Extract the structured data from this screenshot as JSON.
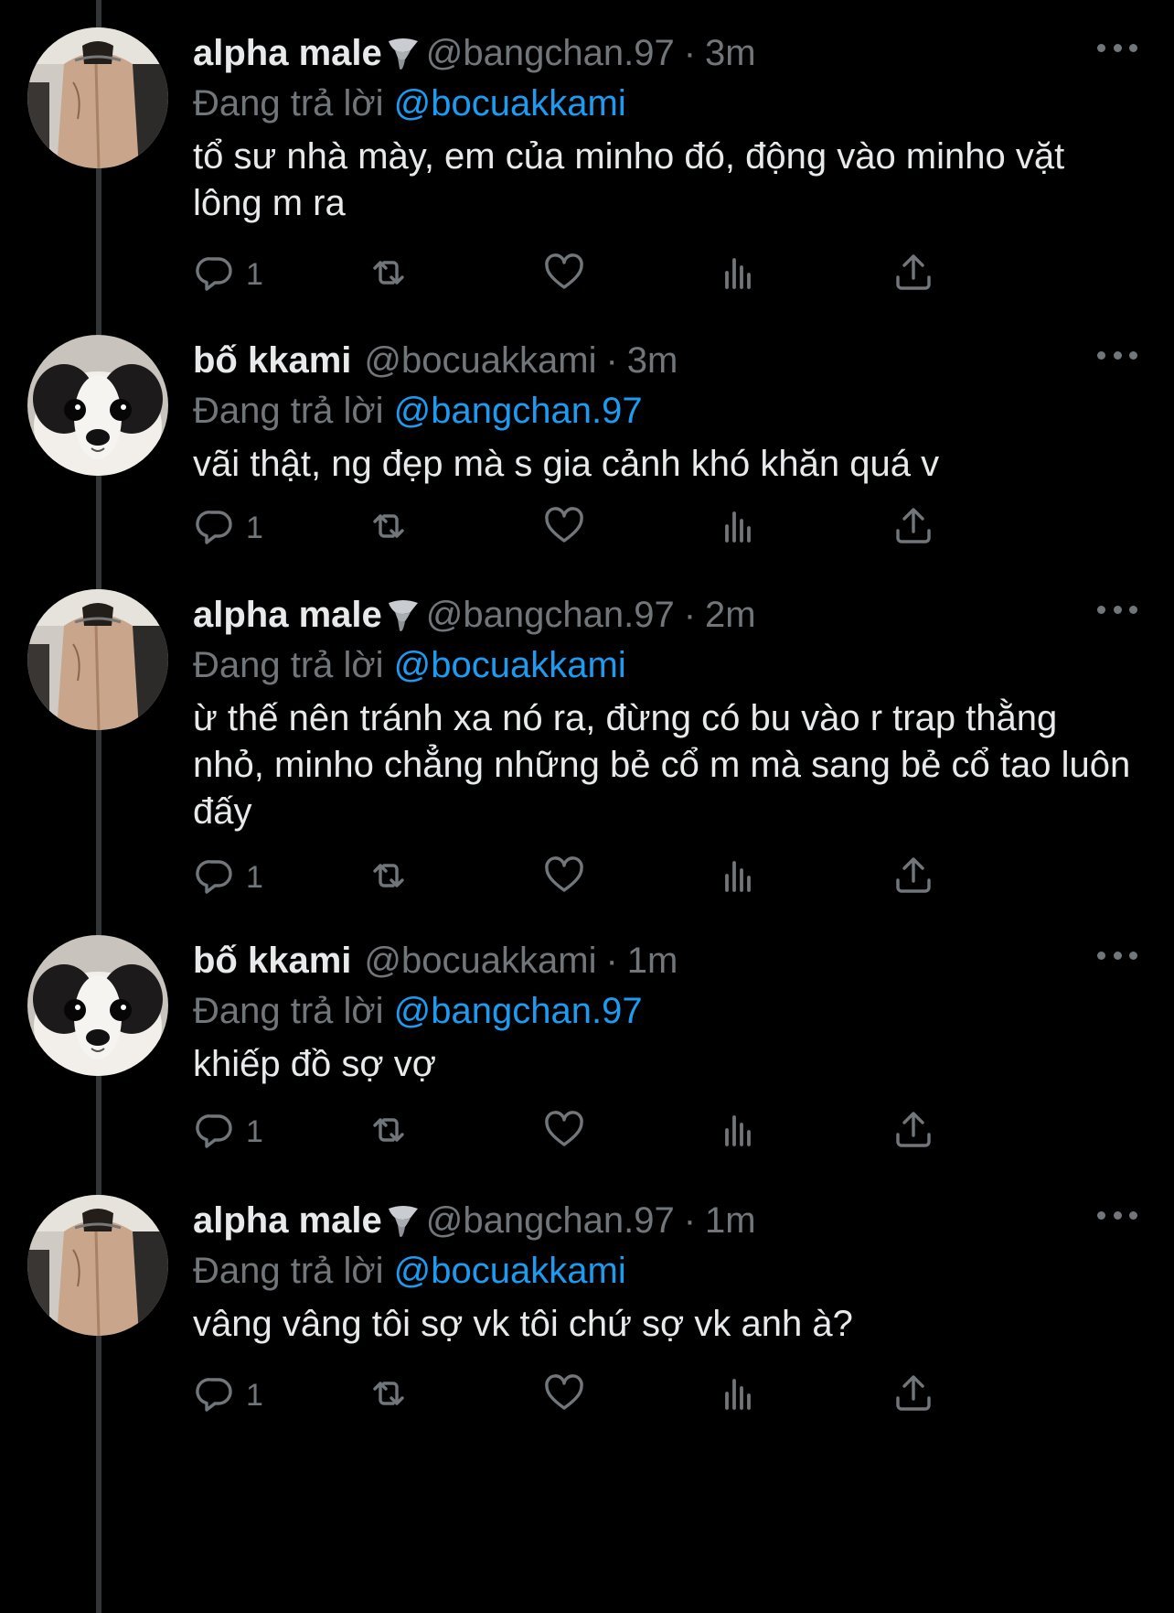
{
  "tweets": [
    {
      "author": "alpha male",
      "avatar": "shirtless-back-photo",
      "handle": "@bangchan.97",
      "dot": "·",
      "time": "3m",
      "reply_prefix": "Đang trả lời",
      "reply_to": "@bocuakkami",
      "text": "tổ sư nhà mày, em của minho đó, động vào minho vặt lông m ra",
      "reply_count": "1"
    },
    {
      "author": "bố kkami",
      "avatar": "dog-photo",
      "handle": "@bocuakkami",
      "dot": "·",
      "time": "3m",
      "reply_prefix": "Đang trả lời",
      "reply_to": "@bangchan.97",
      "text": "vãi thật, ng đẹp mà s gia cảnh khó khăn quá v",
      "reply_count": "1"
    },
    {
      "author": "alpha male",
      "avatar": "shirtless-back-photo",
      "handle": "@bangchan.97",
      "dot": "·",
      "time": "2m",
      "reply_prefix": "Đang trả lời",
      "reply_to": "@bocuakkami",
      "text": "ừ thế nên tránh xa nó ra, đừng có bu vào r trap thằng nhỏ, minho chẳng những bẻ cổ m mà sang bẻ cổ tao luôn đấy",
      "reply_count": "1"
    },
    {
      "author": "bố kkami",
      "avatar": "dog-photo",
      "handle": "@bocuakkami",
      "dot": "·",
      "time": "1m",
      "reply_prefix": "Đang trả lời",
      "reply_to": "@bangchan.97",
      "text": "khiếp đồ sợ vợ",
      "reply_count": "1"
    },
    {
      "author": "alpha male",
      "avatar": "shirtless-back-photo",
      "handle": "@bangchan.97",
      "dot": "·",
      "time": "1m",
      "reply_prefix": "Đang trả lời",
      "reply_to": "@bocuakkami",
      "text": "vâng vâng tôi sợ vk tôi chứ sợ vk anh à?",
      "reply_count": "1"
    }
  ],
  "icons": {
    "badge": "tornado-emoji",
    "more": "more-icon",
    "reply": "reply-icon",
    "retweet": "retweet-icon",
    "like": "heart-icon",
    "views": "views-icon",
    "share": "share-icon"
  },
  "colors": {
    "background": "#000000",
    "text": "#e7e9ea",
    "muted": "#71767b",
    "mention": "#1d9bf0",
    "thread_line": "#333639"
  }
}
